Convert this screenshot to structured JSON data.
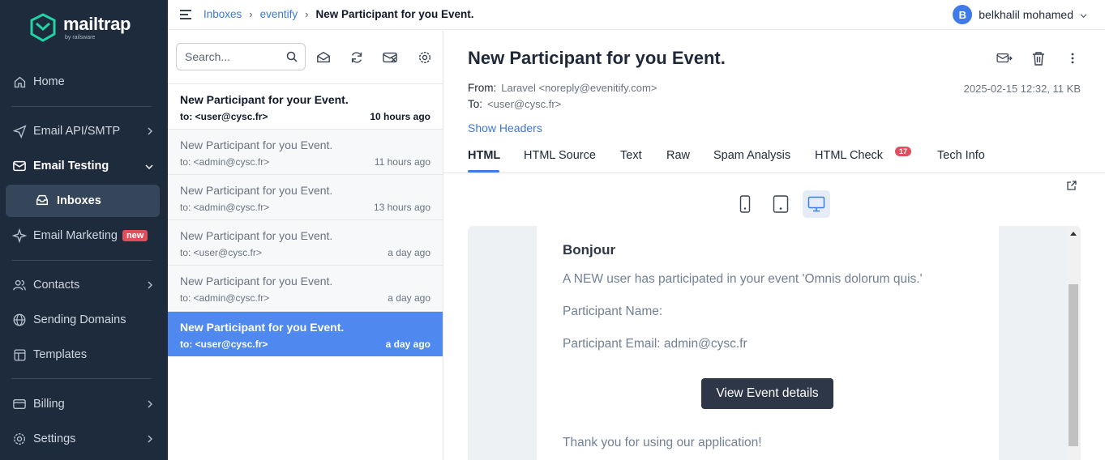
{
  "brand": {
    "name": "mailtrap",
    "sub": "by railsware"
  },
  "sidebar": {
    "items": [
      {
        "label": "Home"
      },
      {
        "label": "Email API/SMTP"
      },
      {
        "label": "Email Testing"
      },
      {
        "label": "Inboxes"
      },
      {
        "label": "Email Marketing",
        "badge": "new"
      },
      {
        "label": "Contacts"
      },
      {
        "label": "Sending Domains"
      },
      {
        "label": "Templates"
      },
      {
        "label": "Billing"
      },
      {
        "label": "Settings"
      }
    ]
  },
  "topbar": {
    "breadcrumb": [
      "Inboxes",
      "eventify",
      "New Participant for you Event."
    ],
    "user": {
      "initial": "B",
      "name": "belkhalil mohamed"
    }
  },
  "list": {
    "search_placeholder": "Search...",
    "messages": [
      {
        "subject": "New Participant for your Event.",
        "to": "to: <user@cysc.fr>",
        "time": "10 hours ago",
        "state": "unread"
      },
      {
        "subject": "New Participant for you Event.",
        "to": "to: <admin@cysc.fr>",
        "time": "11 hours ago",
        "state": "read"
      },
      {
        "subject": "New Participant for you Event.",
        "to": "to: <admin@cysc.fr>",
        "time": "13 hours ago",
        "state": "read"
      },
      {
        "subject": "New Participant for you Event.",
        "to": "to: <user@cysc.fr>",
        "time": "a day ago",
        "state": "read"
      },
      {
        "subject": "New Participant for you Event.",
        "to": "to: <admin@cysc.fr>",
        "time": "a day ago",
        "state": "read"
      },
      {
        "subject": "New Participant for you Event.",
        "to": "to: <user@cysc.fr>",
        "time": "a day ago",
        "state": "selected"
      }
    ]
  },
  "preview": {
    "title": "New Participant for you Event.",
    "from_label": "From:",
    "from": "Laravel <noreply@evenitify.com>",
    "to_label": "To:",
    "to": "<user@cysc.fr>",
    "meta": "2025-02-15 12:32, 11 KB",
    "show_headers": "Show Headers",
    "tabs": [
      "HTML",
      "HTML Source",
      "Text",
      "Raw",
      "Spam Analysis",
      "HTML Check",
      "Tech Info"
    ],
    "html_check_count": "17",
    "email": {
      "greeting": "Bonjour",
      "line1": "A NEW user has participated in your event 'Omnis dolorum quis.'",
      "line2": "Participant Name:",
      "line3": "Participant Email: admin@cysc.fr",
      "button": "View Event details",
      "line4": "Thank you for using our application!"
    }
  },
  "colors": {
    "sidebar_bg": "#1e2b3c",
    "accent": "#3f7be8",
    "selected_row": "#4f88ee",
    "badge": "#e24d5c"
  }
}
